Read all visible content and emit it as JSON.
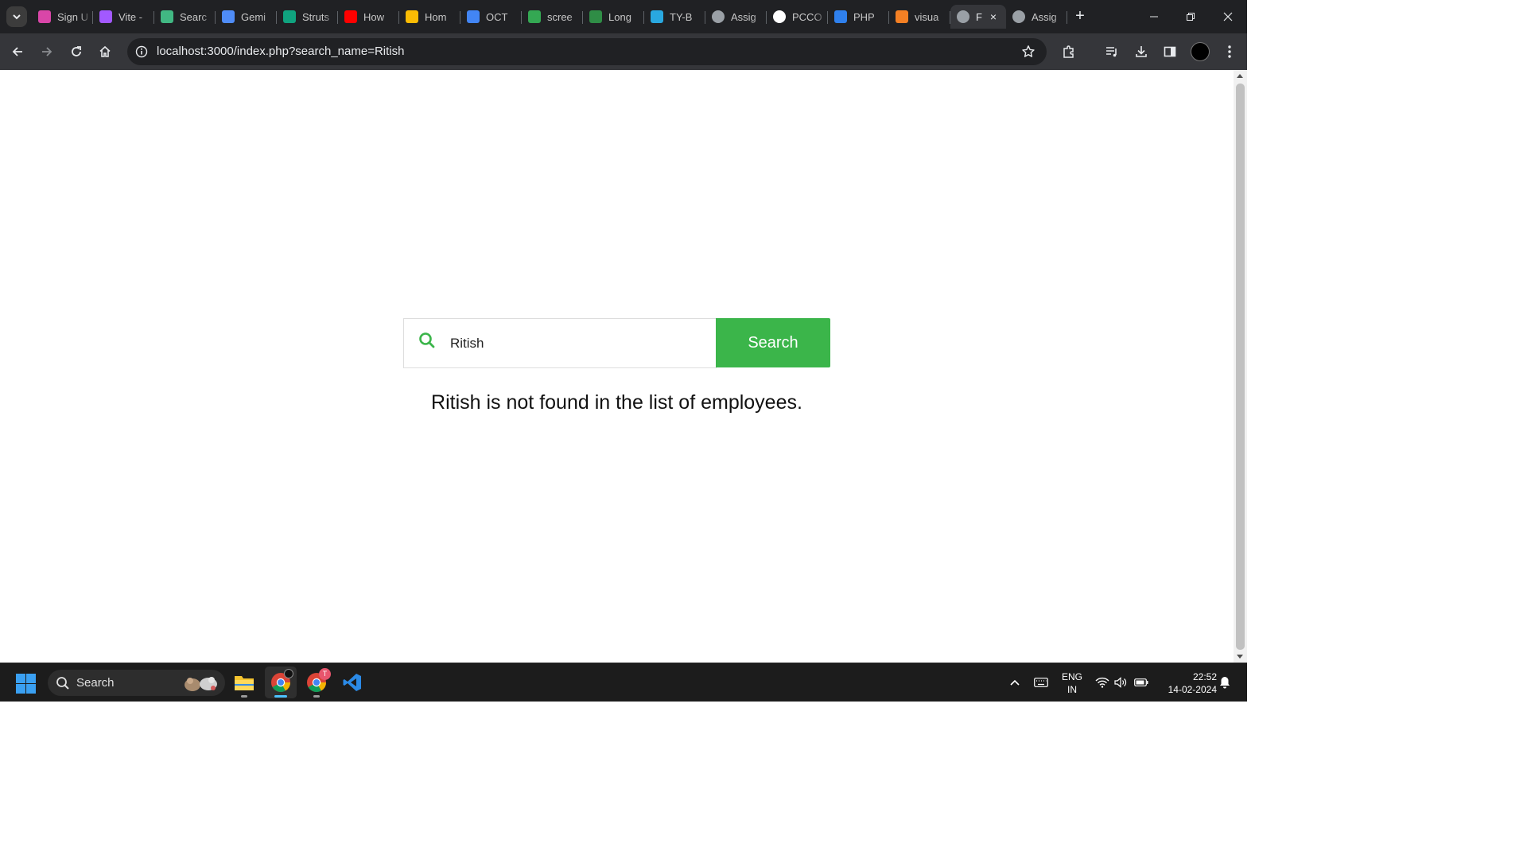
{
  "browser": {
    "tabs": [
      {
        "title": "Sign U",
        "icon": "target-app-icon",
        "color": "#d946a8"
      },
      {
        "title": "Vite -",
        "icon": "vite-icon",
        "color": "#a259ff"
      },
      {
        "title": "Searc",
        "icon": "vue-icon",
        "color": "#41b883"
      },
      {
        "title": "Gemi",
        "icon": "gemini-icon",
        "color": "#4f8cf7"
      },
      {
        "title": "Struts",
        "icon": "chatgpt-icon",
        "color": "#10a37f"
      },
      {
        "title": "How",
        "icon": "youtube-icon",
        "color": "#ff0000"
      },
      {
        "title": "Hom",
        "icon": "google-drive-icon",
        "color": "#fbbc04"
      },
      {
        "title": "OCT",
        "icon": "google-docs-icon",
        "color": "#4285f4"
      },
      {
        "title": "scree",
        "icon": "google-drive-icon",
        "color": "#34a853"
      },
      {
        "title": "Long",
        "icon": "geeksforgeeks-icon",
        "color": "#2f8d46"
      },
      {
        "title": "TY-B",
        "icon": "website-icon",
        "color": "#29a8e0"
      },
      {
        "title": "Assig",
        "icon": "globe-icon",
        "color": "#9aa0a6"
      },
      {
        "title": "PCCO",
        "icon": "github-icon",
        "color": "#ffffff"
      },
      {
        "title": "PHP",
        "icon": "vscode-icon",
        "color": "#2f80ed"
      },
      {
        "title": "visua",
        "icon": "stackoverflow-icon",
        "color": "#f48024"
      }
    ],
    "active_tab": {
      "title": "F",
      "icon": "globe-icon",
      "close": "×"
    },
    "after_tab": {
      "title": "Assig",
      "icon": "globe-icon"
    },
    "new_tab": "+",
    "url": "localhost:3000/index.php?search_name=Ritish"
  },
  "page": {
    "search_value": "Ritish",
    "search_button": "Search",
    "message": "Ritish is not found in the list of employees.",
    "accent_color": "#3bb54a"
  },
  "taskbar": {
    "search_label": "Search",
    "apps": [
      "file-explorer-icon",
      "chrome-icon",
      "chrome-profile-icon",
      "vscode-icon"
    ],
    "chrome_badge": "T",
    "lang_line1": "ENG",
    "lang_line2": "IN",
    "time": "22:52",
    "date": "14-02-2024"
  }
}
